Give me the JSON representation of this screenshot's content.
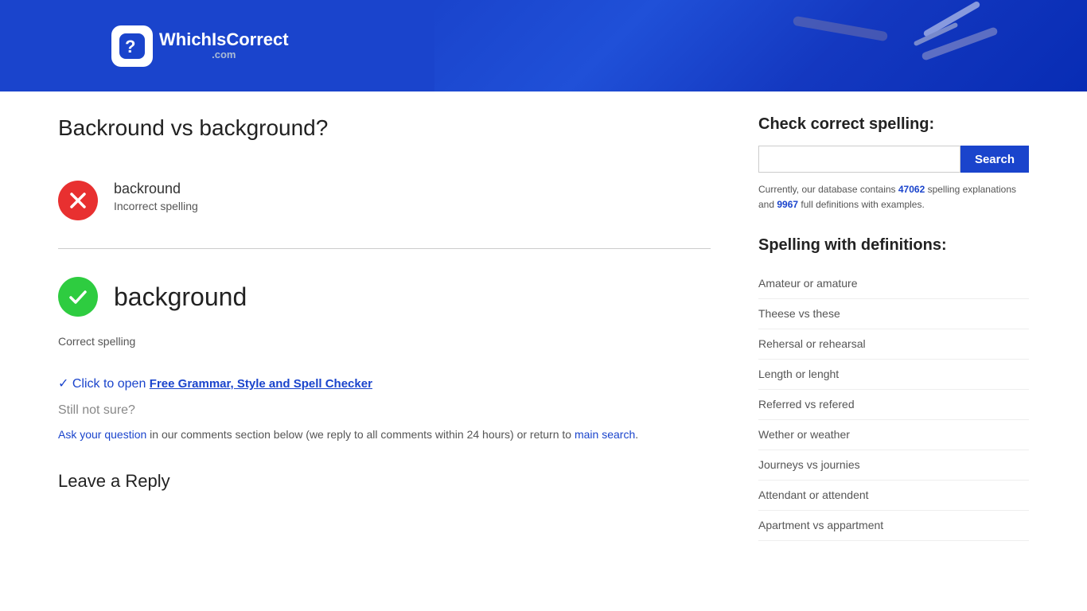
{
  "header": {
    "logo_text": "WhichIsCorrect",
    "logo_sub": ".com",
    "logo_icon": "?"
  },
  "page": {
    "title": "Backround vs background?",
    "incorrect_word": "backround",
    "incorrect_label": "Incorrect spelling",
    "correct_word": "background",
    "correct_label": "Correct spelling",
    "grammar_checker_prefix": "✓ Click to open ",
    "grammar_checker_link": "Free Grammar, Style and Spell Checker",
    "grammar_checker_url": "#",
    "still_not_sure": "Still not sure?",
    "ask_text": "Ask your question",
    "ask_url": "#",
    "ask_suffix": " in our comments section below (we reply to all comments within 24 hours) or return to ",
    "main_search_text": "main search",
    "main_search_url": "#",
    "main_search_suffix": ".",
    "leave_reply": "Leave a Reply"
  },
  "sidebar": {
    "check_spelling_title": "Check correct spelling:",
    "search_placeholder": "",
    "search_button_label": "Search",
    "db_info_prefix": "Currently, our database contains ",
    "db_count1": "47062",
    "db_info_middle": " spelling explanations and ",
    "db_count2": "9967",
    "db_info_suffix": " full definitions with examples.",
    "spelling_defs_title": "Spelling with definitions:",
    "spelling_links": [
      {
        "label": "Amateur or amature",
        "url": "#"
      },
      {
        "label": "Theese vs these",
        "url": "#"
      },
      {
        "label": "Rehersal or rehearsal",
        "url": "#"
      },
      {
        "label": "Length or lenght",
        "url": "#"
      },
      {
        "label": "Referred vs refered",
        "url": "#"
      },
      {
        "label": "Wether or weather",
        "url": "#"
      },
      {
        "label": "Journeys vs journies",
        "url": "#"
      },
      {
        "label": "Attendant or attendent",
        "url": "#"
      },
      {
        "label": "Apartment vs appartment",
        "url": "#"
      }
    ]
  }
}
